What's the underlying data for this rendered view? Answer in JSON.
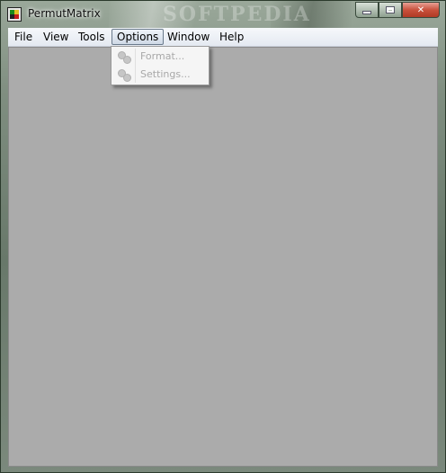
{
  "window": {
    "title": "PermutMatrix",
    "watermark": "SOFTPEDIA"
  },
  "menubar": {
    "items": [
      {
        "label": "File"
      },
      {
        "label": "View"
      },
      {
        "label": "Tools"
      },
      {
        "label": "Options",
        "open": true
      },
      {
        "label": "Window"
      },
      {
        "label": "Help"
      }
    ]
  },
  "options_menu": {
    "items": [
      {
        "label": "Format...",
        "enabled": false,
        "icon": "gears-icon"
      },
      {
        "label": "Settings...",
        "enabled": false,
        "icon": "gears-icon"
      }
    ]
  },
  "colors": {
    "client_background": "#ababab",
    "disabled_text": "#a8a8a8"
  }
}
